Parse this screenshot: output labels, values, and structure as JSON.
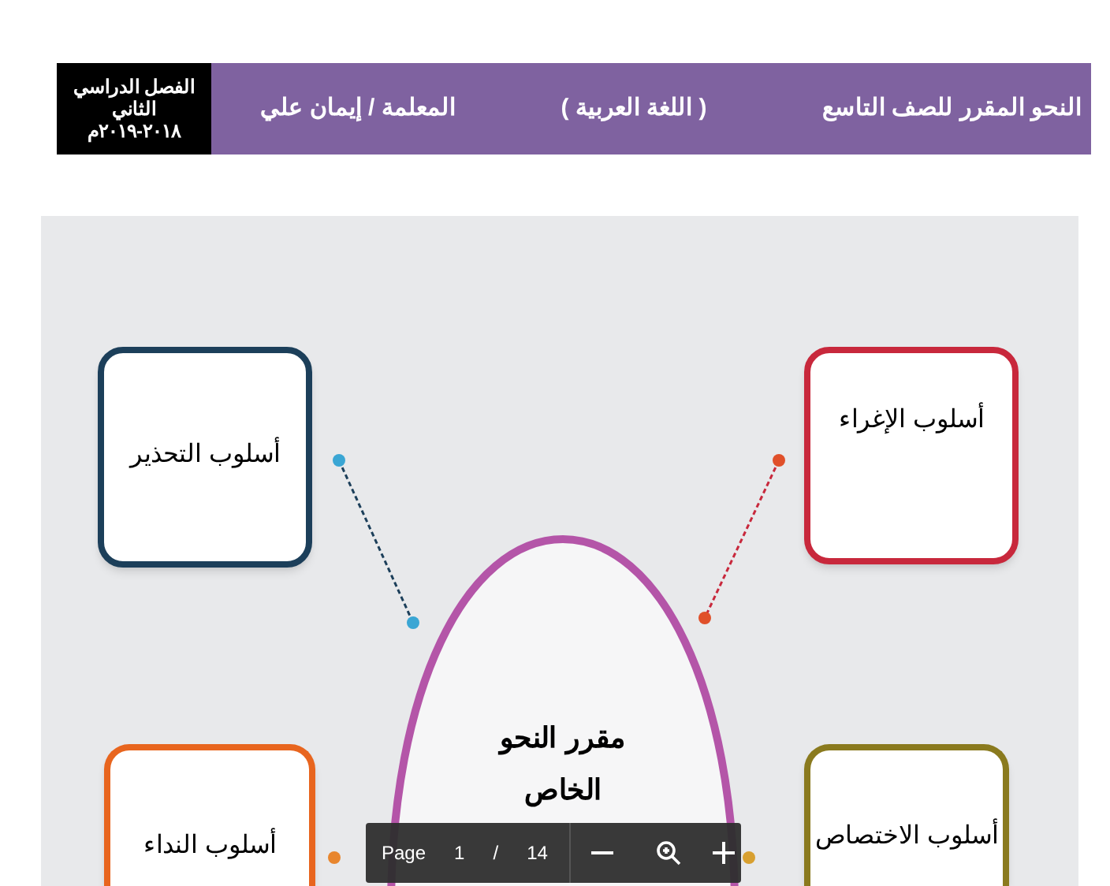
{
  "header": {
    "title": "النحو المقرر للصف التاسع",
    "subject": "( اللغة العربية )",
    "teacher": "المعلمة / إيمان علي",
    "term": "الفصل الدراسي الثاني ٢٠١٨-٢٠١٩م"
  },
  "mind_map": {
    "center": [
      "مقرر النحو",
      "الخاص"
    ],
    "branches": [
      {
        "label": "أسلوب الإغراء",
        "color": "#c8283c"
      },
      {
        "label": "أسلوب التحذير",
        "color": "#1c3f5a"
      },
      {
        "label": "أسلوب الاختصاص",
        "color": "#8a7a1e"
      },
      {
        "label": "أسلوب النداء",
        "color": "#e8651e"
      }
    ]
  },
  "viewer_toolbar": {
    "page_label": "Page",
    "page": "1",
    "separator": "/",
    "total": "14"
  }
}
